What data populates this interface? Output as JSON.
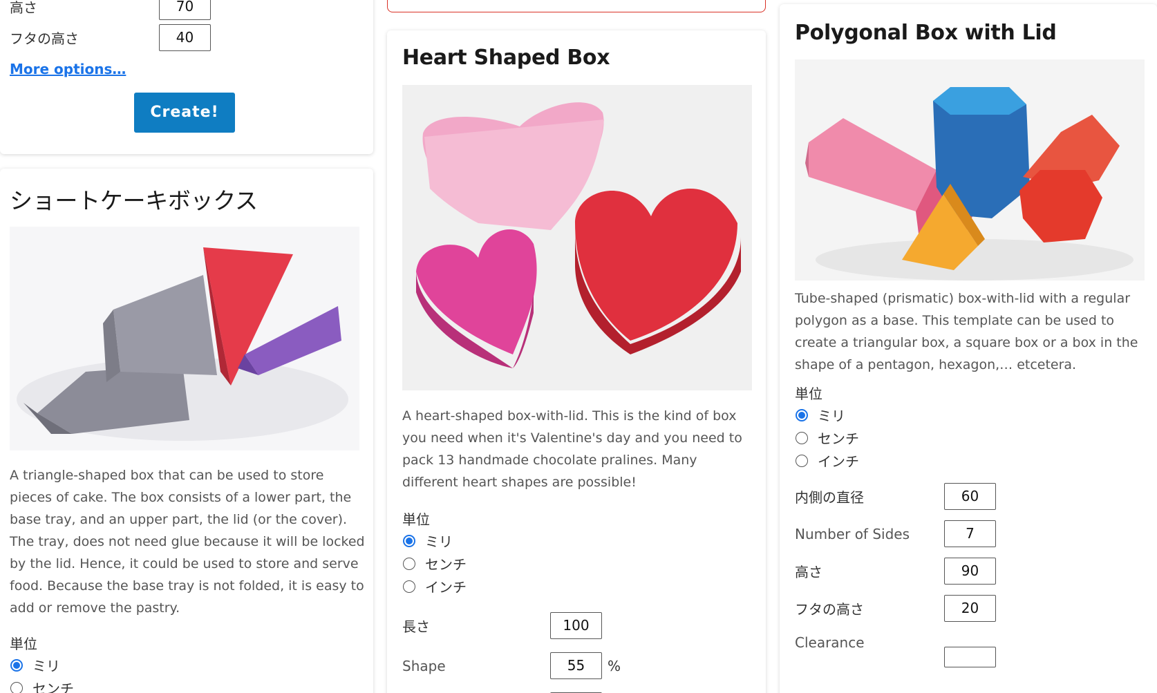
{
  "left_top": {
    "partial_label": "高さ",
    "partial_value": "70",
    "lid_height_label": "フタの高さ",
    "lid_height_value": "40",
    "more_options": "More options…",
    "create_button": "Create!"
  },
  "cake_card": {
    "title": "ショートケーキボックス",
    "description": "A triangle-shaped box that can be used to store pieces of cake. The box consists of a lower part, the base tray, and an upper part, the lid (or the cover). The tray, does not need glue because it will be locked by the lid. Hence, it could be used to store and serve food. Because the base tray is not folded, it is easy to add or remove the pastry.",
    "unit_label": "単位",
    "units": [
      "ミリ",
      "センチ"
    ]
  },
  "heart_card": {
    "title": "Heart Shaped Box",
    "description": "A heart-shaped box-with-lid. This is the kind of box you need when it's Valentine's day and you need to pack 13 handmade chocolate pralines. Many different heart shapes are possible!",
    "unit_label": "単位",
    "units": [
      "ミリ",
      "センチ",
      "インチ"
    ],
    "length_label": "長さ",
    "length_value": "100",
    "shape_label": "Shape",
    "shape_value": "55",
    "shape_unit": "%"
  },
  "polygon_card": {
    "title": "Polygonal Box with Lid",
    "description": "Tube-shaped (prismatic) box-with-lid with a regular polygon as a base. This template can be used to create a triangular box, a square box or a box in the shape of a pentagon, hexagon,… etcetera.",
    "unit_label": "単位",
    "units": [
      "ミリ",
      "センチ",
      "インチ"
    ],
    "diameter_label": "内側の直径",
    "diameter_value": "60",
    "sides_label": "Number of Sides",
    "sides_value": "7",
    "height_label": "高さ",
    "height_value": "90",
    "lid_height_label": "フタの高さ",
    "lid_height_value": "20",
    "clearance_label": "Clearance"
  },
  "colors": {
    "accent": "#1a73e8",
    "button": "#0f7dc2",
    "highlight_border": "#d93025"
  }
}
